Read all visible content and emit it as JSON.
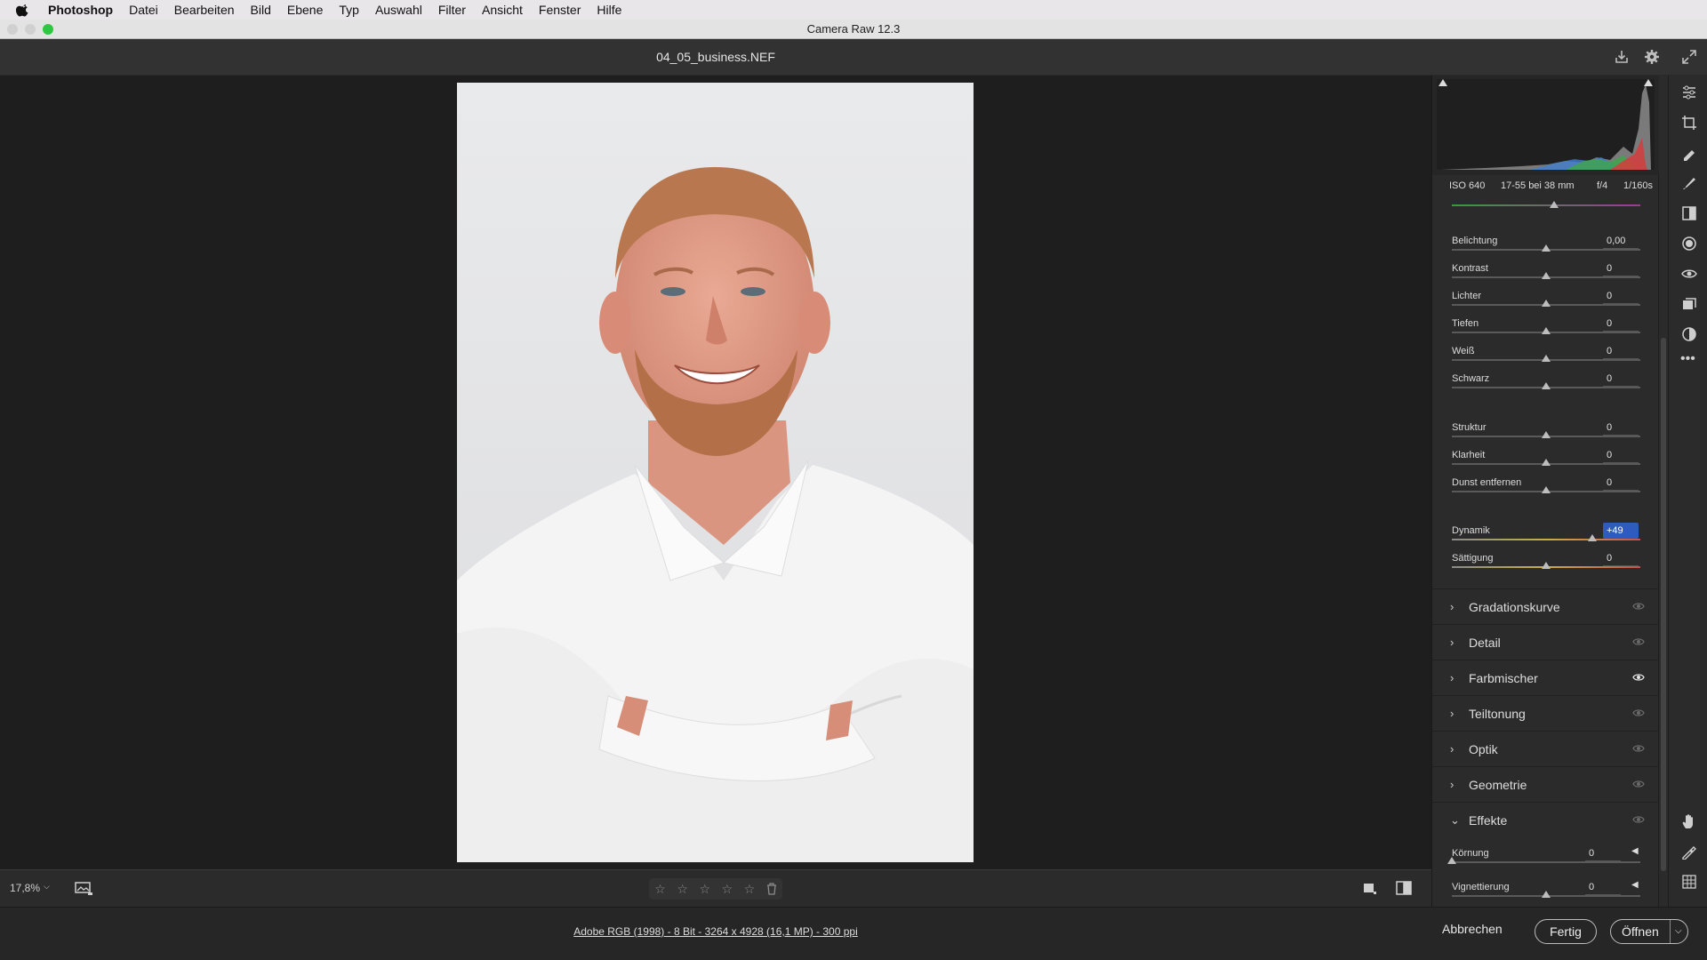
{
  "menubar": {
    "app": "Photoshop",
    "items": [
      "Datei",
      "Bearbeiten",
      "Bild",
      "Ebene",
      "Typ",
      "Auswahl",
      "Filter",
      "Ansicht",
      "Fenster",
      "Hilfe"
    ]
  },
  "window": {
    "title": "Camera Raw 12.3"
  },
  "header": {
    "filename": "04_05_business.NEF",
    "icons": [
      "save-icon",
      "gear-icon",
      "fullscreen-icon"
    ]
  },
  "histogram": {
    "exif": {
      "iso": "ISO 640",
      "lens": "17-55 bei 38 mm",
      "aperture": "f/4",
      "shutter": "1/160s"
    }
  },
  "sliders": [
    {
      "label": "Belichtung",
      "value": "0,00",
      "level": 0.5
    },
    {
      "label": "Kontrast",
      "value": "0",
      "level": 0.5
    },
    {
      "label": "Lichter",
      "value": "0",
      "level": 0.5
    },
    {
      "label": "Tiefen",
      "value": "0",
      "level": 0.5
    },
    {
      "label": "Weiß",
      "value": "0",
      "level": 0.5
    },
    {
      "label": "Schwarz",
      "value": "0",
      "level": 0.5
    },
    {
      "label": "Struktur",
      "value": "0",
      "level": 0.5
    },
    {
      "label": "Klarheit",
      "value": "0",
      "level": 0.5
    },
    {
      "label": "Dunst entfernen",
      "value": "0",
      "level": 0.5
    },
    {
      "label": "Dynamik",
      "value": "+49",
      "level": 0.745
    },
    {
      "label": "Sättigung",
      "value": "0",
      "level": 0.5
    }
  ],
  "sections": [
    {
      "label": "Gradationskurve",
      "expanded": false,
      "eye_active": false
    },
    {
      "label": "Detail",
      "expanded": false,
      "eye_active": false
    },
    {
      "label": "Farbmischer",
      "expanded": false,
      "eye_active": true
    },
    {
      "label": "Teiltonung",
      "expanded": false,
      "eye_active": false
    },
    {
      "label": "Optik",
      "expanded": false,
      "eye_active": false
    },
    {
      "label": "Geometrie",
      "expanded": false,
      "eye_active": false
    },
    {
      "label": "Effekte",
      "expanded": true,
      "eye_active": false
    }
  ],
  "effects": [
    {
      "label": "Körnung",
      "value": "0",
      "level": 0
    },
    {
      "label": "Vignettierung",
      "value": "0",
      "level": 0.5
    }
  ],
  "previewbar": {
    "zoom": "17,8%",
    "stars": 5
  },
  "footer": {
    "fileinfo": "Adobe RGB (1998) - 8 Bit - 3264 x 4928 (16,1 MP) - 300 ppi",
    "cancel": "Abbrechen",
    "done": "Fertig",
    "open": "Öffnen"
  },
  "colors": {
    "accent_selected": "#2f5bbe",
    "panel_bg": "#2b2b2b",
    "preview_bg": "#1e1e1e"
  }
}
